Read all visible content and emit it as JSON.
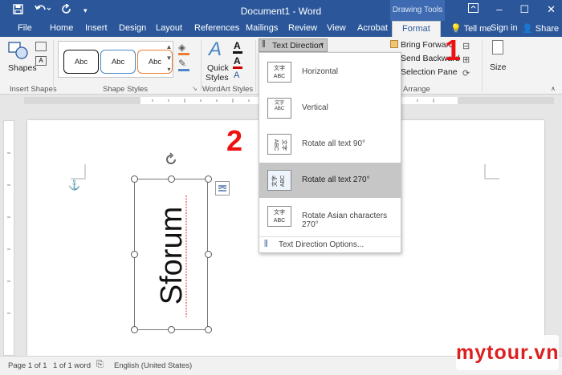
{
  "app": {
    "window_title": "Document1 - Word",
    "context_tab_group": "Drawing Tools",
    "quick_access": {
      "save_icon": "save-icon",
      "undo_icon": "undo-icon",
      "redo_icon": "redo-icon"
    }
  },
  "tabs": [
    "File",
    "Home",
    "Insert",
    "Design",
    "Layout",
    "References",
    "Mailings",
    "Review",
    "View",
    "Acrobat",
    "Format"
  ],
  "active_tab": "Format",
  "tell_me": "Tell me",
  "sign_in": "Sign in",
  "share": "Share",
  "ribbon": {
    "insert_shapes": {
      "shapes_label": "Shapes",
      "group_label": "Insert Shapes"
    },
    "shape_styles": {
      "samples": [
        "Abc",
        "Abc",
        "Abc"
      ],
      "group_label": "Shape Styles"
    },
    "wordart_styles": {
      "quick_styles_line1": "Quick",
      "quick_styles_line2": "Styles",
      "group_label": "WordArt Styles"
    },
    "text_direction_button": "Text Direction",
    "arrange": {
      "bring_forward": "Bring Forward",
      "send_backward": "Send Backward",
      "selection_pane": "Selection Pane",
      "group_label": "Arrange"
    },
    "size_label": "Size"
  },
  "dropdown": {
    "items": [
      {
        "label": "Horizontal",
        "icon": "horizontal-text-icon",
        "glyph_top": "文字",
        "glyph_bottom": "ABC"
      },
      {
        "label": "Vertical",
        "icon": "vertical-text-icon",
        "glyph_top": "文字",
        "glyph_bottom": "ABC"
      },
      {
        "label": "Rotate all text 90°",
        "icon": "rotate-90-icon",
        "glyph_top": "文字",
        "glyph_bottom": "ABC"
      },
      {
        "label": "Rotate all text 270°",
        "icon": "rotate-270-icon",
        "glyph_top": "文字",
        "glyph_bottom": "ABC"
      },
      {
        "label": "Rotate Asian characters 270°",
        "icon": "rotate-asian-270-icon",
        "glyph_top": "文字",
        "glyph_bottom": "ABC"
      }
    ],
    "selected_index": 3,
    "options_label": "Text Direction Options..."
  },
  "document": {
    "textbox_text": "Sforum"
  },
  "annotations": {
    "step1": "1",
    "step2": "2"
  },
  "status": {
    "page": "Page 1 of 1",
    "words": "1 of 1 word",
    "language": "English (United States)"
  },
  "watermark": "mytour.vn",
  "colors": {
    "word_blue": "#2b579a",
    "annotation_red": "#e11111",
    "selected_item": "#c6c6c6"
  }
}
